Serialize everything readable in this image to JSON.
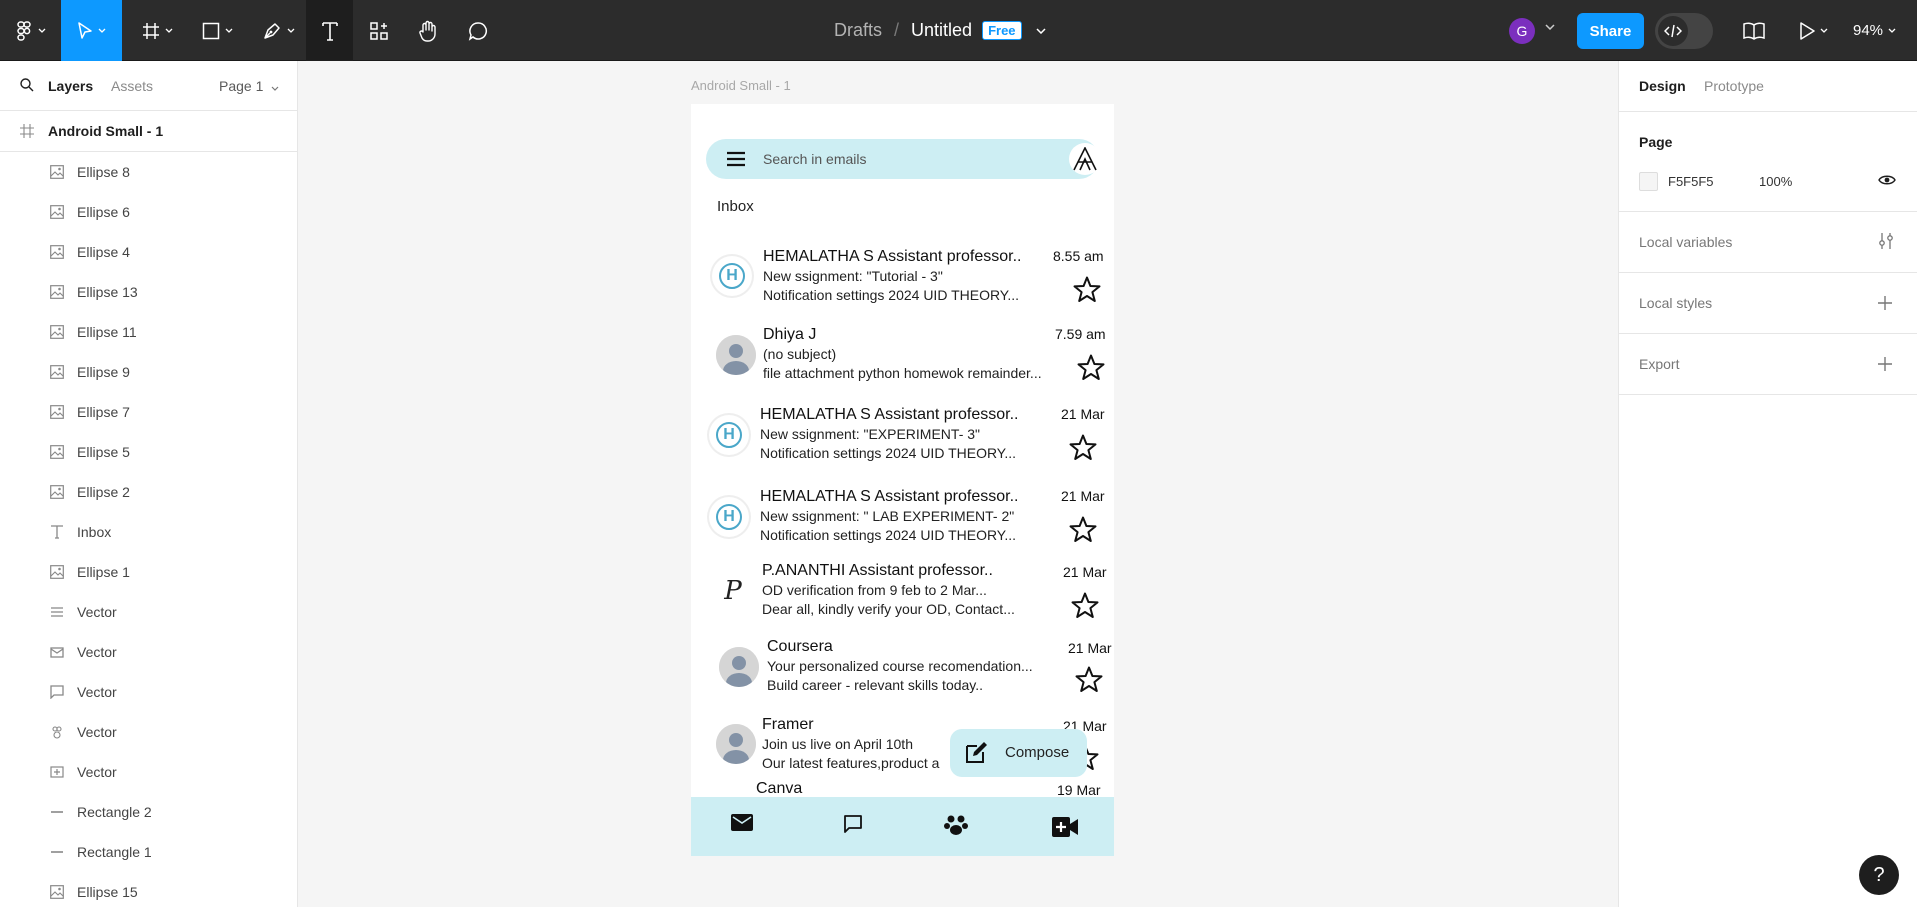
{
  "toolbar": {
    "breadcrumb_folder": "Drafts",
    "breadcrumb_sep": "/",
    "file_title": "Untitled",
    "plan_badge": "Free",
    "avatar_letter": "G",
    "share_label": "Share",
    "zoom": "94%",
    "colors": {
      "bar": "#2c2c2c",
      "accent": "#0d99ff",
      "avatar": "#7b2fbe"
    }
  },
  "left_panel": {
    "tab_layers": "Layers",
    "tab_assets": "Assets",
    "page_select": "Page 1",
    "root_frame": "Android Small - 1",
    "layers": [
      {
        "label": "Ellipse 8",
        "icon": "image-icon"
      },
      {
        "label": "Ellipse 6",
        "icon": "image-icon"
      },
      {
        "label": "Ellipse 4",
        "icon": "image-icon"
      },
      {
        "label": "Ellipse 13",
        "icon": "image-icon"
      },
      {
        "label": "Ellipse 11",
        "icon": "image-icon"
      },
      {
        "label": "Ellipse 9",
        "icon": "image-icon"
      },
      {
        "label": "Ellipse 7",
        "icon": "image-icon"
      },
      {
        "label": "Ellipse 5",
        "icon": "image-icon"
      },
      {
        "label": "Ellipse 2",
        "icon": "image-icon"
      },
      {
        "label": "Inbox",
        "icon": "text-icon"
      },
      {
        "label": "Ellipse 1",
        "icon": "image-icon"
      },
      {
        "label": "Vector",
        "icon": "menu-vector-icon"
      },
      {
        "label": "Vector",
        "icon": "mail-vector-icon"
      },
      {
        "label": "Vector",
        "icon": "chat-vector-icon"
      },
      {
        "label": "Vector",
        "icon": "group-vector-icon"
      },
      {
        "label": "Vector",
        "icon": "video-vector-icon"
      },
      {
        "label": "Rectangle 2",
        "icon": "line-icon"
      },
      {
        "label": "Rectangle 1",
        "icon": "line-icon"
      },
      {
        "label": "Ellipse 15",
        "icon": "image-icon"
      }
    ]
  },
  "canvas": {
    "frame_label": "Android Small - 1",
    "search_placeholder": "Search in emails",
    "inbox_label": "Inbox",
    "compose_label": "Compose",
    "colors": {
      "search_bg": "#cdeef3",
      "nav_bg": "#cdeef3"
    },
    "emails": [
      {
        "sender": "HEMALATHA S Assistant professor..",
        "line1": "New ssignment: \"Tutorial - 3\"",
        "line2": "Notification settings 2024 UID THEORY...",
        "time": "8.55 am",
        "avatar": "h-logo-avatar"
      },
      {
        "sender": "Dhiya J",
        "line1": "(no subject)",
        "line2": "file attachment python homewok remainder...",
        "time": "7.59 am",
        "avatar": "person-avatar"
      },
      {
        "sender": "HEMALATHA S Assistant professor..",
        "line1": "New ssignment: \"EXPERIMENT- 3\"",
        "line2": "Notification settings 2024 UID THEORY...",
        "time": "21 Mar",
        "avatar": "h-logo-avatar"
      },
      {
        "sender": "HEMALATHA S Assistant professor..",
        "line1": "New ssignment: \" LAB EXPERIMENT- 2\"",
        "line2": "Notification settings 2024 UID THEORY...",
        "time": "21 Mar",
        "avatar": "h-logo-avatar"
      },
      {
        "sender": "P.ANANTHI Assistant professor..",
        "line1": "OD verification from 9 feb to 2 Mar...",
        "line2": "Dear all, kindly verify your OD, Contact...",
        "time": "21 Mar",
        "avatar": "p-letter-avatar"
      },
      {
        "sender": "Coursera",
        "line1": "Your personalized course recomendation...",
        "line2": "Build career - relevant skills today..",
        "time": "21 Mar",
        "avatar": "person-avatar"
      },
      {
        "sender": "Framer",
        "line1": "Join us live on April 10th",
        "line2": "Our latest features,product a",
        "time": "21 Mar",
        "avatar": "person-avatar"
      },
      {
        "sender": "Canva",
        "line1": "",
        "line2": "",
        "time": "19 Mar",
        "avatar": "c-letter-avatar"
      }
    ]
  },
  "right_panel": {
    "tab_design": "Design",
    "tab_prototype": "Prototype",
    "page_title": "Page",
    "page_color": "F5F5F5",
    "page_opacity": "100%",
    "local_variables": "Local variables",
    "local_styles": "Local styles",
    "export": "Export"
  },
  "help_label": "?"
}
